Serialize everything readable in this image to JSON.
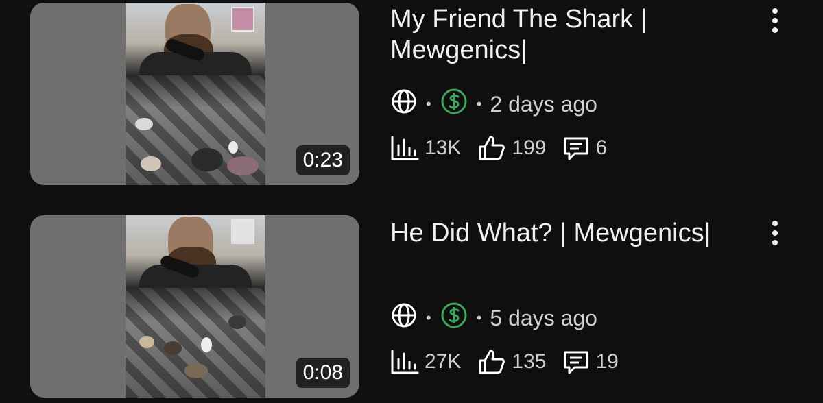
{
  "videos": [
    {
      "title": "My Friend The Shark | Mewgenics|",
      "duration": "0:23",
      "meta": {
        "visibility_icon": "globe-icon",
        "monetization_icon": "dollar-icon",
        "monetization_color": "#3ea45a",
        "uploaded": "2 days ago"
      },
      "stats": {
        "views": "13K",
        "likes": "199",
        "comments": "6"
      }
    },
    {
      "title": "He Did What? | Mewgenics|",
      "duration": "0:08",
      "meta": {
        "visibility_icon": "globe-icon",
        "monetization_icon": "dollar-icon",
        "monetization_color": "#3ea45a",
        "uploaded": "5 days ago"
      },
      "stats": {
        "views": "27K",
        "likes": "135",
        "comments": "19"
      }
    }
  ],
  "separator": "•"
}
